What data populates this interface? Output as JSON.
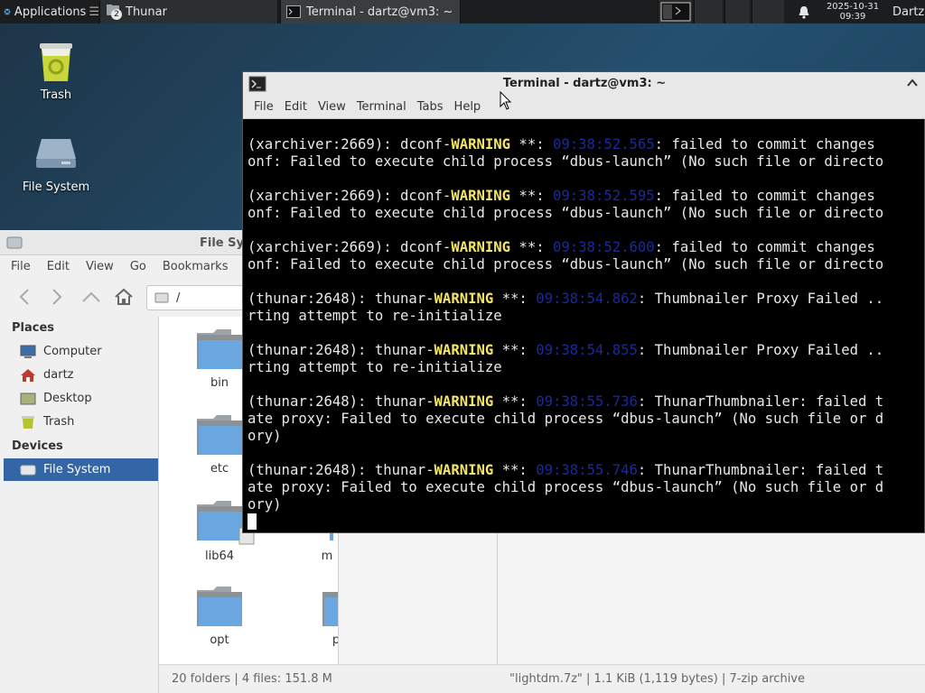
{
  "panel": {
    "apps_label": "Applications",
    "tasks": [
      {
        "label": "Thunar",
        "badge": "2"
      },
      {
        "label": "Terminal - dartz@vm3: ~"
      }
    ],
    "clock_date": "2025-10-31",
    "clock_time": "09:39",
    "user": "Dartz"
  },
  "desktop": {
    "icons": [
      {
        "label": "Trash"
      },
      {
        "label": "File System"
      }
    ]
  },
  "thunar": {
    "title": "File Sy",
    "menu": [
      "File",
      "Edit",
      "View",
      "Go",
      "Bookmarks"
    ],
    "path": "/",
    "places_header": "Places",
    "places": [
      "Computer",
      "dartz",
      "Desktop",
      "Trash"
    ],
    "devices_header": "Devices",
    "devices": [
      "File System"
    ],
    "files": [
      "bin",
      "etc",
      "lib64",
      "m",
      "opt",
      "p"
    ],
    "status_left": "20 folders  |  4 files: 151.8 M",
    "status_right": "\"lightdm.7z\"  |  1.1 KiB (1,119 bytes)  |  7-zip archive"
  },
  "terminal": {
    "title": "Terminal - dartz@vm3: ~",
    "menu": [
      "File",
      "Edit",
      "View",
      "Terminal",
      "Tabs",
      "Help"
    ],
    "blocks": [
      {
        "pre": "(xarchiver:2669): dconf-",
        "warn": "WARNING",
        "mid": " **: ",
        "ts": "09:38:52.565",
        "post": ": failed to commit changes",
        "cont": [
          "onf: Failed to execute child process “dbus-launch” (No such file or directo"
        ]
      },
      {
        "pre": "(xarchiver:2669): dconf-",
        "warn": "WARNING",
        "mid": " **: ",
        "ts": "09:38:52.595",
        "post": ": failed to commit changes",
        "cont": [
          "onf: Failed to execute child process “dbus-launch” (No such file or directo"
        ]
      },
      {
        "pre": "(xarchiver:2669): dconf-",
        "warn": "WARNING",
        "mid": " **: ",
        "ts": "09:38:52.600",
        "post": ": failed to commit changes",
        "cont": [
          "onf: Failed to execute child process “dbus-launch” (No such file or directo"
        ]
      },
      {
        "pre": "(thunar:2648): thunar-",
        "warn": "WARNING",
        "mid": " **: ",
        "ts": "09:38:54.862",
        "post": ": Thumbnailer Proxy Failed ..",
        "cont": [
          "rting attempt to re-initialize"
        ]
      },
      {
        "pre": "(thunar:2648): thunar-",
        "warn": "WARNING",
        "mid": " **: ",
        "ts": "09:38:54.855",
        "post": ": Thumbnailer Proxy Failed ..",
        "cont": [
          "rting attempt to re-initialize"
        ]
      },
      {
        "pre": "(thunar:2648): thunar-",
        "warn": "WARNING",
        "mid": " **: ",
        "ts": "09:38:55.736",
        "post": ": ThunarThumbnailer: failed t",
        "cont": [
          "ate proxy: Failed to execute child process “dbus-launch” (No such file or d",
          "ory)"
        ]
      },
      {
        "pre": "(thunar:2648): thunar-",
        "warn": "WARNING",
        "mid": " **: ",
        "ts": "09:38:55.746",
        "post": ": ThunarThumbnailer: failed t",
        "cont": [
          "ate proxy: Failed to execute child process “dbus-launch” (No such file or d",
          "ory)"
        ]
      }
    ]
  },
  "colors": {
    "panel": "#1b1d1f",
    "selection": "#3465a4",
    "warning": "#f5e664",
    "timestamp": "#1a2a9a"
  }
}
